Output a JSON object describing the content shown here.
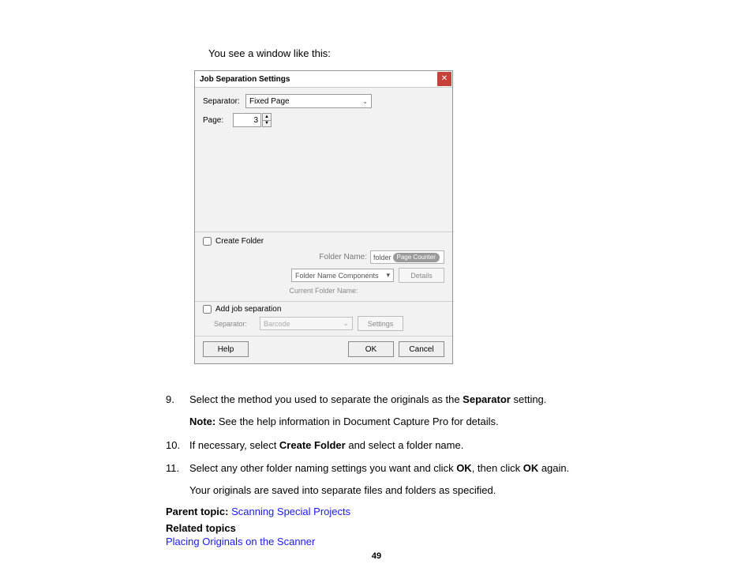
{
  "intro": "You see a window like this:",
  "dialog": {
    "title": "Job Separation Settings",
    "separator_label": "Separator:",
    "separator_value": "Fixed Page",
    "page_label": "Page:",
    "page_value": "3",
    "create_folder_label": "Create Folder",
    "folder_name_label": "Folder Name:",
    "folder_name_text": "folder",
    "folder_tag": "Page Counter",
    "fnc_label": "Folder Name Components",
    "details_label": "Details",
    "cfn_label": "Current Folder Name:",
    "add_jobsep_label": "Add job separation",
    "js_separator_label": "Separator:",
    "js_separator_value": "Barcode",
    "js_settings_label": "Settings",
    "help_label": "Help",
    "ok_label": "OK",
    "cancel_label": "Cancel"
  },
  "steps": {
    "s9_num": "9.",
    "s9_a": "Select the method you used to separate the originals as the ",
    "s9_b": "Separator",
    "s9_c": " setting.",
    "note_label": "Note:",
    "note_text": " See the help information in Document Capture Pro for details.",
    "s10_num": "10.",
    "s10_a": "If necessary, select ",
    "s10_b": "Create Folder",
    "s10_c": " and select a folder name.",
    "s11_num": "11.",
    "s11_a": "Select any other folder naming settings you want and click ",
    "s11_b": "OK",
    "s11_c": ", then click ",
    "s11_d": "OK",
    "s11_e": " again.",
    "saved": "Your originals are saved into separate files and folders as specified."
  },
  "meta": {
    "parent_label": "Parent topic: ",
    "parent_link": "Scanning Special Projects",
    "related_label": "Related topics",
    "related_link": "Placing Originals on the Scanner"
  },
  "page_number": "49"
}
